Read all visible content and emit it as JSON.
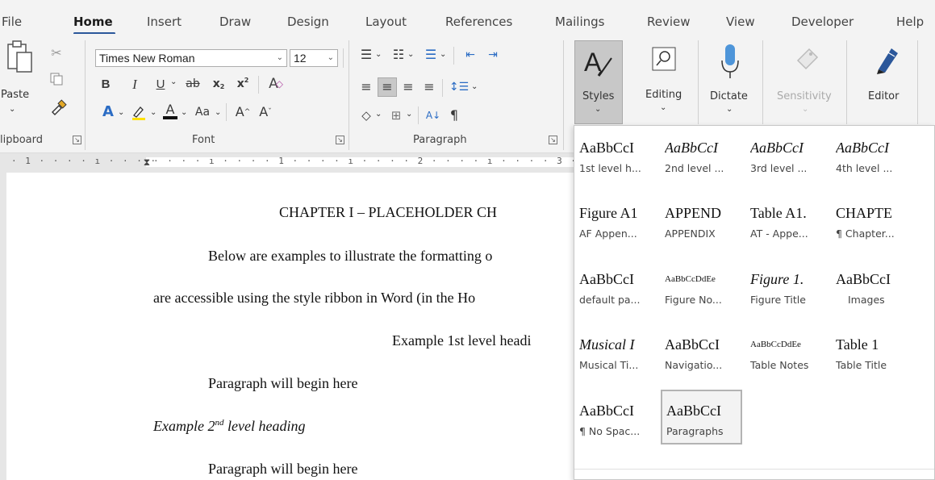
{
  "tabs": [
    "File",
    "Home",
    "Insert",
    "Draw",
    "Design",
    "Layout",
    "References",
    "Mailings",
    "Review",
    "View",
    "Developer",
    "Help"
  ],
  "accent_color": "#2b579a",
  "clipboard": {
    "paste_label": "Paste",
    "group_label": "lipboard",
    "icons": [
      "paste-icon",
      "cut-icon",
      "copy-icon",
      "format-painter-icon"
    ]
  },
  "font": {
    "name": "Times New Roman",
    "size": "12",
    "group_label": "Font",
    "bold": "B",
    "italic": "I",
    "underline": "U",
    "strike": "ab",
    "subscript": "x",
    "sub_mark": "2",
    "superscript": "x",
    "sup_mark": "2",
    "change_case": "Aa",
    "grow": "A",
    "shrink": "A"
  },
  "paragraph": {
    "group_label": "Paragraph"
  },
  "big_buttons": [
    {
      "label": "Styles",
      "icon": "styles-icon"
    },
    {
      "label": "Editing",
      "icon": "search-icon"
    },
    {
      "label": "Dictate",
      "icon": "microphone-icon"
    },
    {
      "label": "Sensitivity",
      "icon": "sensitivity-icon"
    },
    {
      "label": "Editor",
      "icon": "editor-pen-icon"
    }
  ],
  "ruler": {
    "marks": "· 1 · · · · ı · · · ·",
    "marks2": "· · · · ı · · · · 1 · · · · ı · · · · 2 · · · · ı · · · · 3 · · · · ı ·"
  },
  "document": {
    "lines": [
      "CHAPTER I – PLACEHOLDER CH",
      "Below are examples to illustrate the formatting o",
      "are accessible using the style ribbon in Word (in the Ho",
      "Example 1st level headi",
      "Paragraph will begin here",
      "Paragraph will begin here"
    ],
    "heading2_prefix": "Example 2",
    "heading2_sup": "nd",
    "heading2_suffix": " level heading"
  },
  "styles_gallery": [
    {
      "preview": "AaBbCcI",
      "name": "1st level h..."
    },
    {
      "preview": "AaBbCcI",
      "name": "2nd level ..."
    },
    {
      "preview": "AaBbCcI",
      "name": "3rd level ..."
    },
    {
      "preview": "AaBbCcI",
      "name": "4th level ..."
    },
    {
      "preview": "Figure A1",
      "name": "AF Appen..."
    },
    {
      "preview": "APPEND",
      "name": "APPENDIX"
    },
    {
      "preview": "Table A1.",
      "name": "AT - Appe..."
    },
    {
      "preview": "CHAPTE",
      "name": "¶ Chapter..."
    },
    {
      "preview": "AaBbCcI",
      "name": "default pa..."
    },
    {
      "preview": "AaBbCcDdEe",
      "name": "Figure No..."
    },
    {
      "preview": "Figure 1.",
      "name": "Figure Title"
    },
    {
      "preview": "AaBbCcI",
      "name": "Images"
    },
    {
      "preview": "Musical I",
      "name": "Musical Ti..."
    },
    {
      "preview": "AaBbCcI",
      "name": "Navigatio..."
    },
    {
      "preview": "AaBbCcDdEe",
      "name": "Table Notes"
    },
    {
      "preview": "Table 1",
      "name": "Table Title"
    },
    {
      "preview": "AaBbCcI",
      "name": "¶ No Spac..."
    },
    {
      "preview": "AaBbCcI",
      "name": "Paragraphs"
    }
  ]
}
